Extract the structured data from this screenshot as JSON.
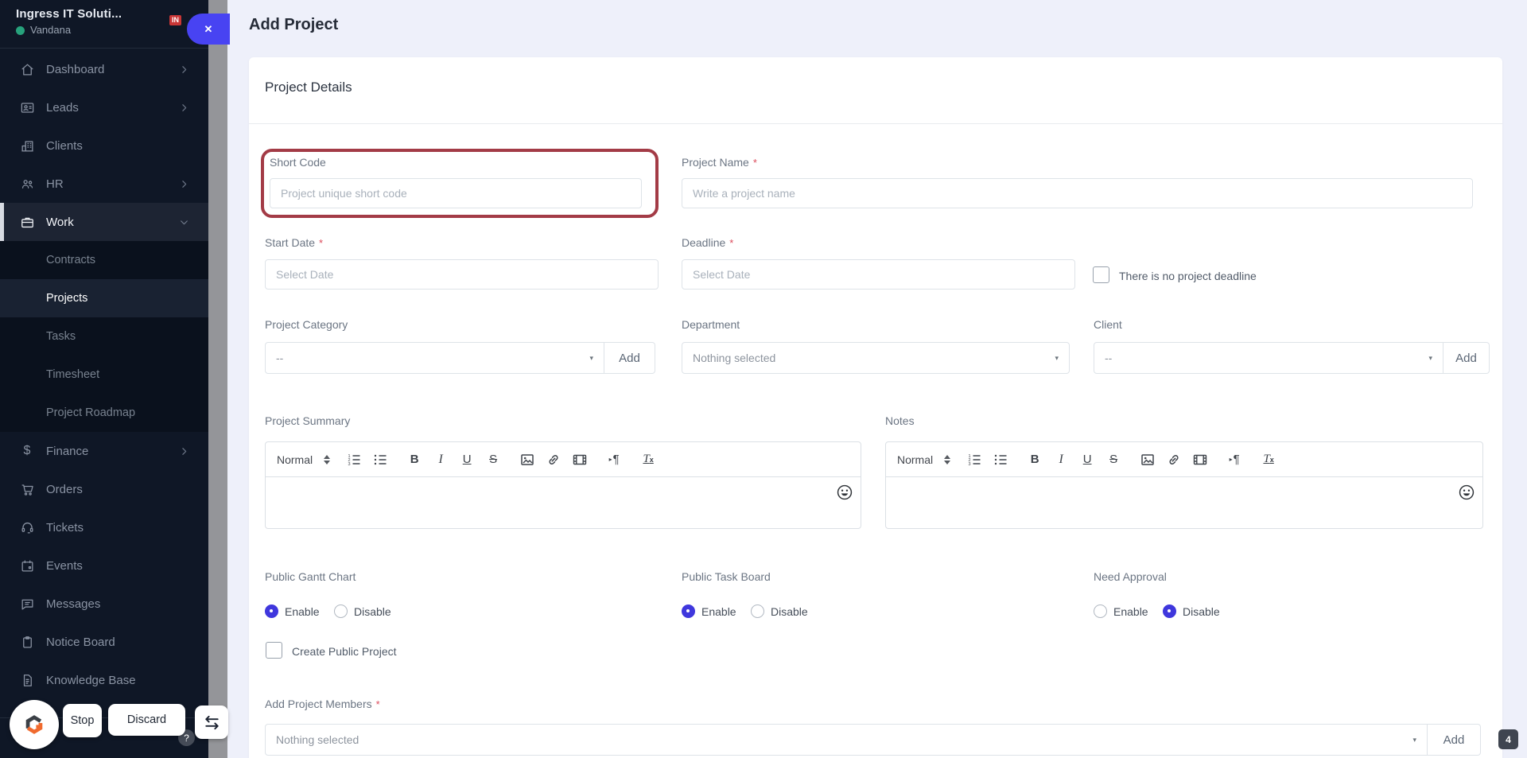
{
  "header": {
    "title": "Add Project"
  },
  "sidebar": {
    "org": "Ingress IT Soluti...",
    "user": "Vandana",
    "mini_logo": "IN",
    "items": [
      {
        "label": "Dashboard",
        "icon": "home",
        "chevron": "right"
      },
      {
        "label": "Leads",
        "icon": "id-card",
        "chevron": "right"
      },
      {
        "label": "Clients",
        "icon": "building",
        "chevron": "none"
      },
      {
        "label": "HR",
        "icon": "people",
        "chevron": "right"
      },
      {
        "label": "Work",
        "icon": "briefcase",
        "chevron": "down",
        "active": true
      },
      {
        "label": "Finance",
        "icon": "dollar",
        "chevron": "right"
      },
      {
        "label": "Orders",
        "icon": "cart",
        "chevron": "none"
      },
      {
        "label": "Tickets",
        "icon": "headset",
        "chevron": "none"
      },
      {
        "label": "Events",
        "icon": "calendar",
        "chevron": "none"
      },
      {
        "label": "Messages",
        "icon": "chat",
        "chevron": "none"
      },
      {
        "label": "Notice Board",
        "icon": "clipboard",
        "chevron": "none"
      },
      {
        "label": "Knowledge Base",
        "icon": "document",
        "chevron": "none"
      }
    ],
    "work_submenu": [
      "Contracts",
      "Projects",
      "Tasks",
      "Timesheet",
      "Project Roadmap"
    ],
    "active_section": "Work",
    "active_page": "Projects"
  },
  "overlay": {
    "stop": "Stop",
    "discard": "Discard",
    "help": "?",
    "badge": "4"
  },
  "icons": {
    "close": "✕",
    "caret": "▾",
    "dollar": "$",
    "bold": "B",
    "italic": "I",
    "underline": "U",
    "strike": "S",
    "pilcrow": "¶",
    "dir_arrow": "▸",
    "clear_t": "T",
    "clear_x": "x"
  },
  "form": {
    "section_title": "Project Details",
    "required_mark": "*",
    "short_code": {
      "label": "Short Code",
      "placeholder": "Project unique short code",
      "value": ""
    },
    "project_name": {
      "label": "Project Name",
      "placeholder": "Write a project name",
      "value": "",
      "required": true
    },
    "start_date": {
      "label": "Start Date",
      "placeholder": "Select Date",
      "value": "",
      "required": true
    },
    "deadline": {
      "label": "Deadline",
      "placeholder": "Select Date",
      "value": "",
      "required": true
    },
    "no_deadline": {
      "label": "There is no project deadline",
      "checked": false
    },
    "project_category": {
      "label": "Project Category",
      "value": "--",
      "add": "Add"
    },
    "department": {
      "label": "Department",
      "value": "Nothing selected"
    },
    "client": {
      "label": "Client",
      "value": "--",
      "add": "Add"
    },
    "project_summary": {
      "label": "Project Summary",
      "format": "Normal",
      "content": ""
    },
    "notes": {
      "label": "Notes",
      "format": "Normal",
      "content": ""
    },
    "public_gantt_chart": {
      "label": "Public Gantt Chart",
      "selected": "Enable"
    },
    "public_task_board": {
      "label": "Public Task Board",
      "selected": "Enable"
    },
    "need_approval": {
      "label": "Need Approval",
      "selected": "Disable"
    },
    "radio": {
      "enable": "Enable",
      "disable": "Disable"
    },
    "create_public_project": {
      "label": "Create Public Project",
      "checked": false
    },
    "members": {
      "label": "Add Project Members",
      "value": "Nothing selected",
      "add": "Add",
      "required": true
    }
  },
  "colors": {
    "accent_blue": "#4843f2",
    "radio_blue": "#3f37dd",
    "highlight_red": "#a33b46",
    "status_green": "#27a27c",
    "sidebar_bg": "#0f1726"
  }
}
